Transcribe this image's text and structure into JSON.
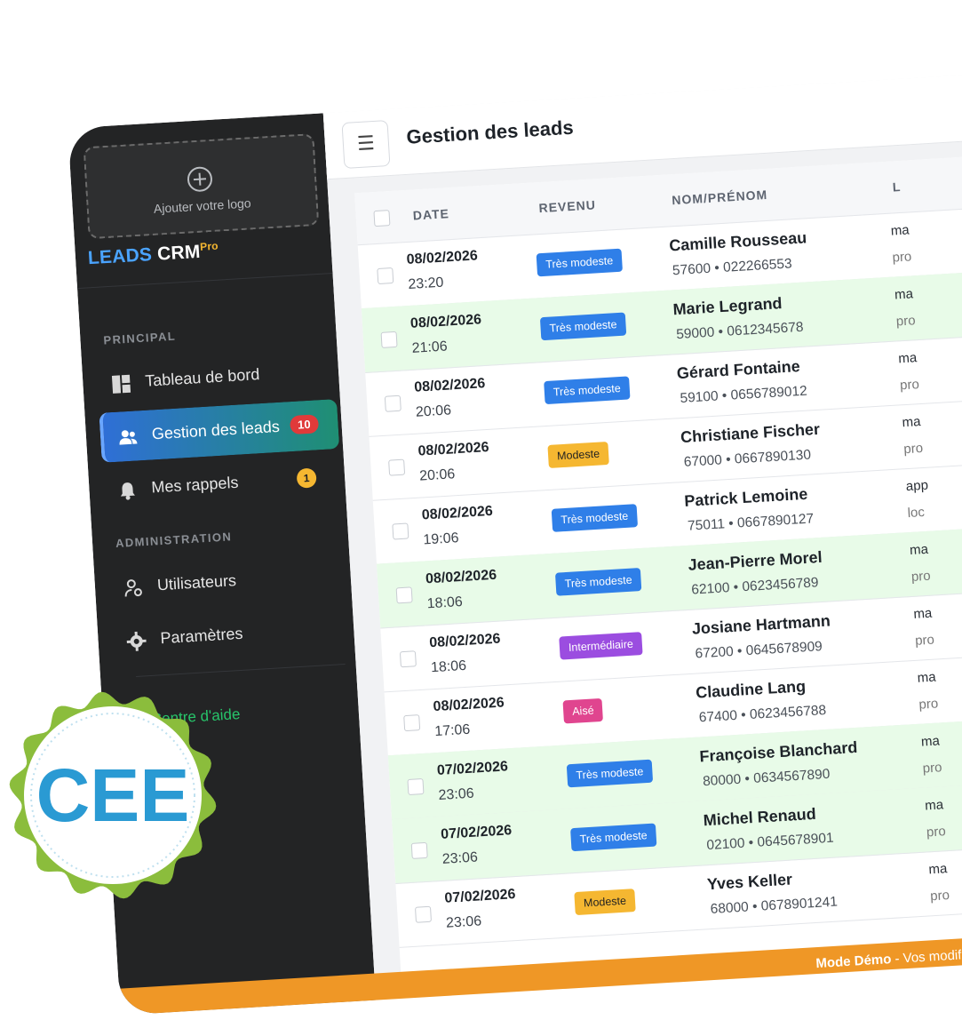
{
  "sidebar": {
    "logo_placeholder": "Ajouter votre logo",
    "brand": {
      "part1": "LEADS",
      "part2": " CRM",
      "sup": "Pro"
    },
    "sections": [
      {
        "label": "PRINCIPAL"
      },
      {
        "label": "ADMINISTRATION"
      }
    ],
    "items": [
      {
        "label": "Tableau de bord",
        "icon": "dashboard-icon"
      },
      {
        "label": "Gestion des leads",
        "icon": "users-icon",
        "badge": "10",
        "active": true
      },
      {
        "label": "Mes rappels",
        "icon": "bell-icon",
        "badge": "1"
      },
      {
        "label": "Utilisateurs",
        "icon": "user-gear-icon"
      },
      {
        "label": "Paramètres",
        "icon": "gear-icon"
      }
    ],
    "help_link": "Centre d'aide"
  },
  "header": {
    "title": "Gestion des leads",
    "menu_icon": "hamburger-icon"
  },
  "table": {
    "columns": [
      "DATE",
      "REVENU",
      "NOM/PRÉNOM",
      "L"
    ],
    "rows": [
      {
        "date": "08/02/2026",
        "time": "23:20",
        "revenu": "Très modeste",
        "name": "Camille Rousseau",
        "cp": "57600",
        "phone": "022266553",
        "c1": "ma",
        "c2": "pro",
        "highlight": false
      },
      {
        "date": "08/02/2026",
        "time": "21:06",
        "revenu": "Très modeste",
        "name": "Marie Legrand",
        "cp": "59000",
        "phone": "0612345678",
        "c1": "ma",
        "c2": "pro",
        "highlight": true
      },
      {
        "date": "08/02/2026",
        "time": "20:06",
        "revenu": "Très modeste",
        "name": "Gérard Fontaine",
        "cp": "59100",
        "phone": "0656789012",
        "c1": "ma",
        "c2": "pro",
        "highlight": false
      },
      {
        "date": "08/02/2026",
        "time": "20:06",
        "revenu": "Modeste",
        "name": "Christiane Fischer",
        "cp": "67000",
        "phone": "0667890130",
        "c1": "ma",
        "c2": "pro",
        "highlight": false
      },
      {
        "date": "08/02/2026",
        "time": "19:06",
        "revenu": "Très modeste",
        "name": "Patrick Lemoine",
        "cp": "75011",
        "phone": "0667890127",
        "c1": "app",
        "c2": "loc",
        "highlight": false
      },
      {
        "date": "08/02/2026",
        "time": "18:06",
        "revenu": "Très modeste",
        "name": "Jean-Pierre Morel",
        "cp": "62100",
        "phone": "0623456789",
        "c1": "ma",
        "c2": "pro",
        "highlight": true
      },
      {
        "date": "08/02/2026",
        "time": "18:06",
        "revenu": "Intermédiaire",
        "name": "Josiane Hartmann",
        "cp": "67200",
        "phone": "0645678909",
        "c1": "ma",
        "c2": "pro",
        "highlight": false
      },
      {
        "date": "08/02/2026",
        "time": "17:06",
        "revenu": "Aisé",
        "name": "Claudine Lang",
        "cp": "67400",
        "phone": "0623456788",
        "c1": "ma",
        "c2": "pro",
        "highlight": false
      },
      {
        "date": "07/02/2026",
        "time": "23:06",
        "revenu": "Très modeste",
        "name": "Françoise Blanchard",
        "cp": "80000",
        "phone": "0634567890",
        "c1": "ma",
        "c2": "pro",
        "highlight": true
      },
      {
        "date": "07/02/2026",
        "time": "23:06",
        "revenu": "Très modeste",
        "name": "Michel Renaud",
        "cp": "02100",
        "phone": "0645678901",
        "c1": "ma",
        "c2": "pro",
        "highlight": true
      },
      {
        "date": "07/02/2026",
        "time": "23:06",
        "revenu": "Modeste",
        "name": "Yves Keller",
        "cp": "68000",
        "phone": "0678901241",
        "c1": "ma",
        "c2": "pro",
        "highlight": false
      }
    ]
  },
  "revenu_colors": {
    "Très modeste": "#2f7fe8",
    "Modeste": "#f5b731",
    "Intermédiaire": "#9b4de0",
    "Aisé": "#e0458f"
  },
  "demo_banner": {
    "bold": "Mode Démo",
    "rest": " - Vos modifications"
  },
  "cee_badge": {
    "text": "CEE",
    "ring_color": "#8bbd3c",
    "text_color": "#2a9ad3"
  }
}
